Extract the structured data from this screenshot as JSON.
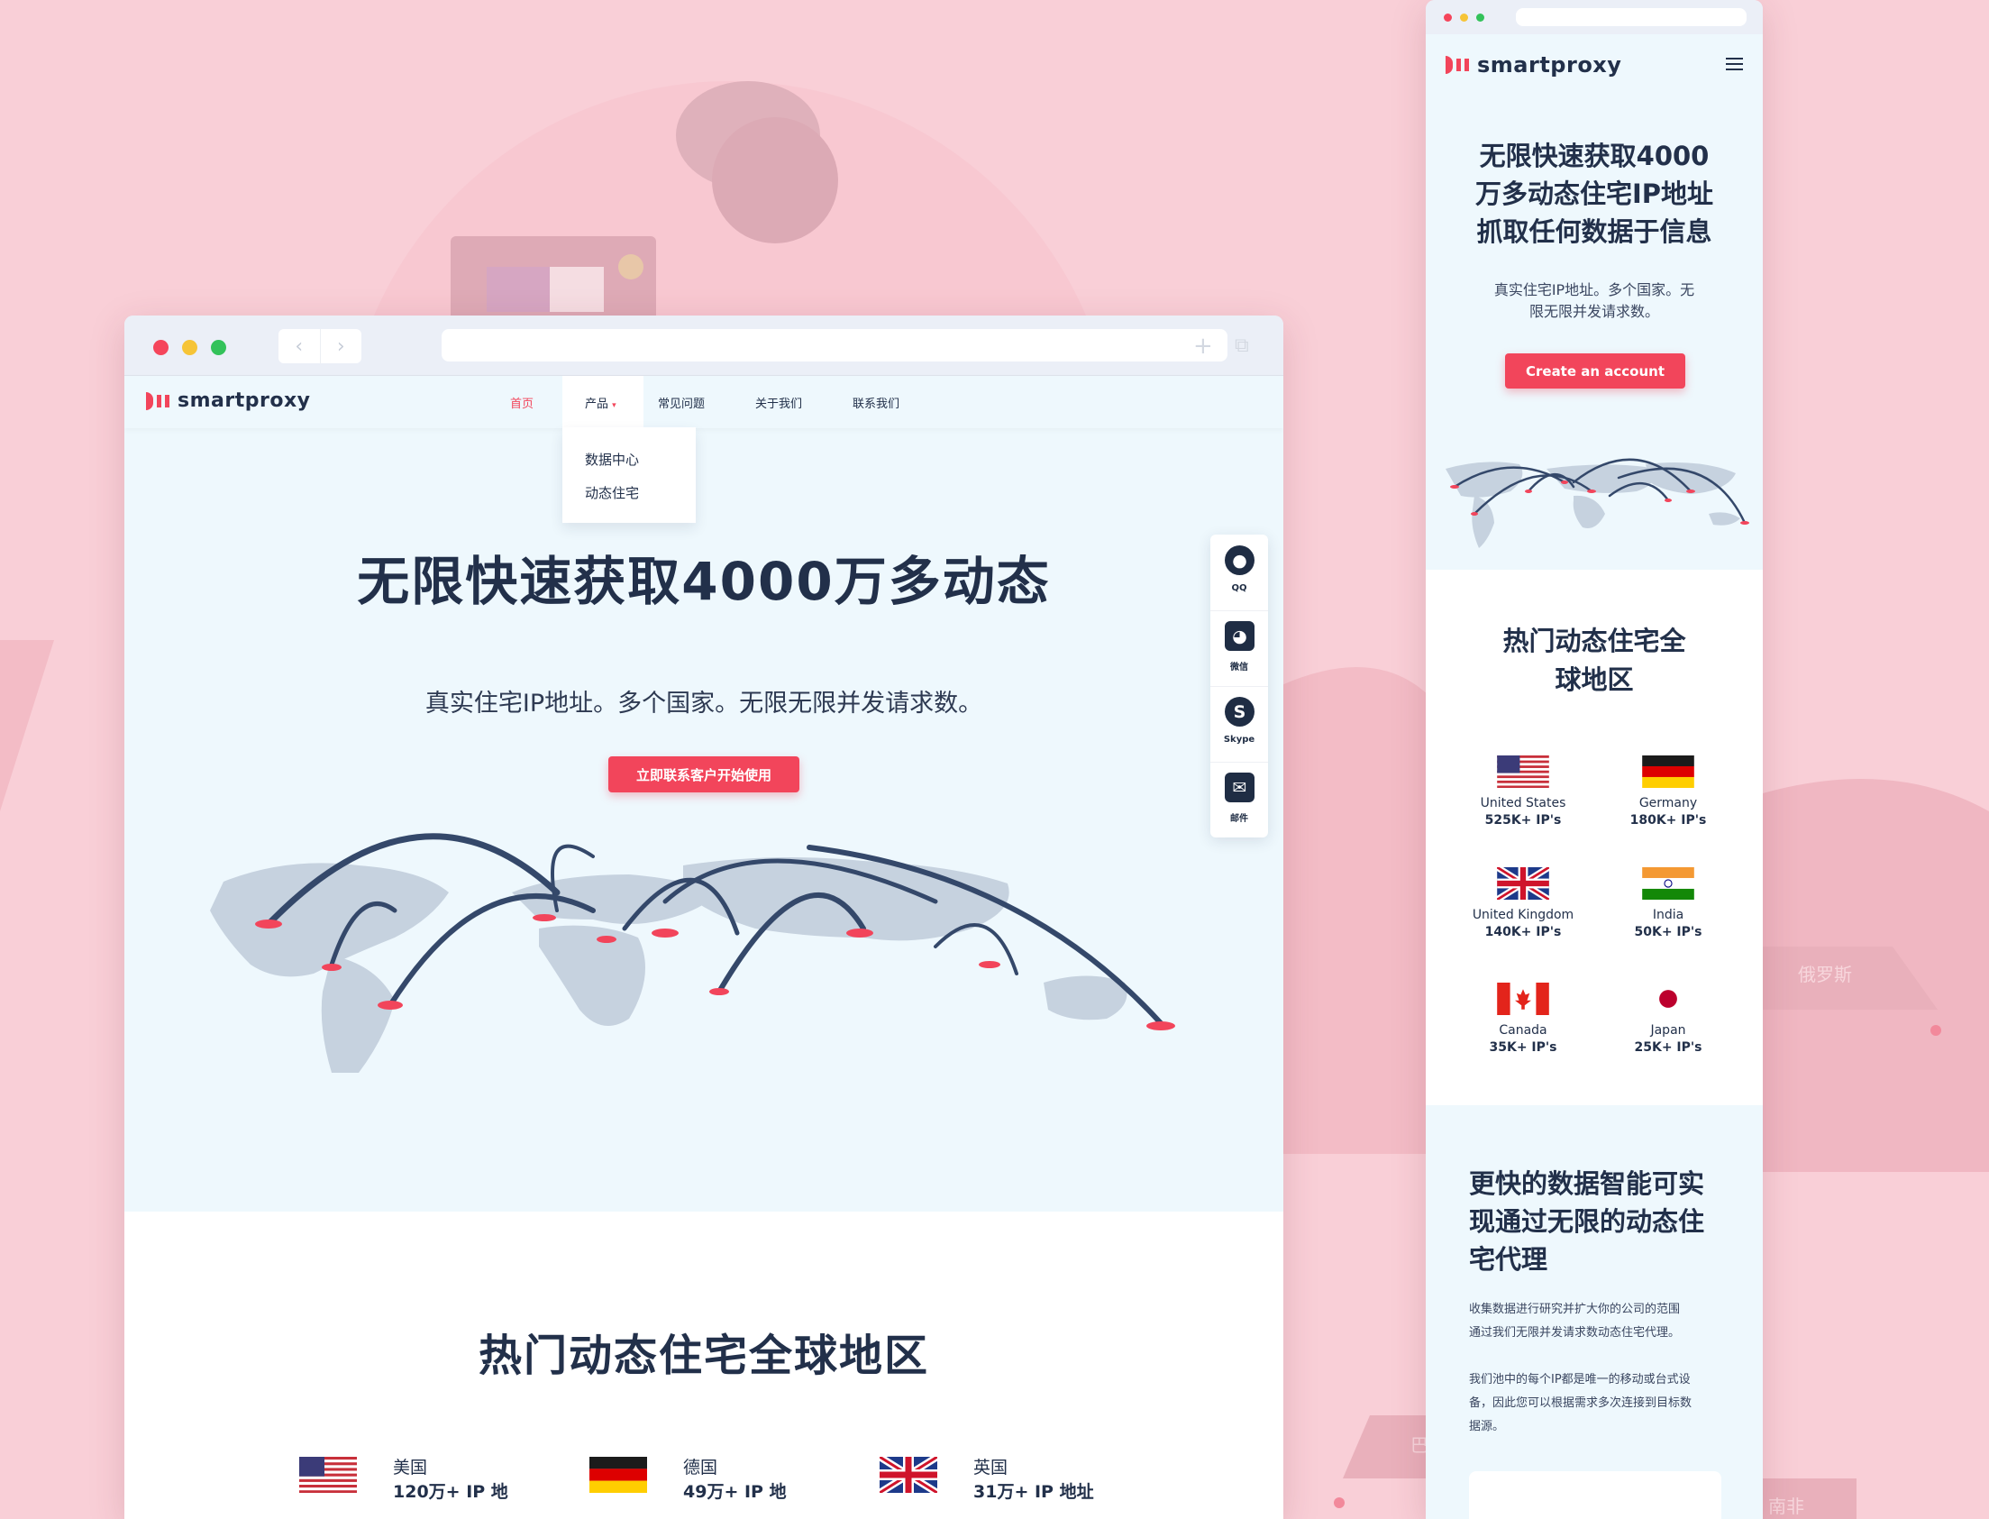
{
  "brand": {
    "name": "smartproxy",
    "accent": "#f2455b",
    "dark": "#22304a"
  },
  "desktop": {
    "nav": [
      {
        "label": "首页",
        "active": true
      },
      {
        "label": "产品",
        "dropdown": true
      },
      {
        "label": "常见问题"
      },
      {
        "label": "关于我们"
      },
      {
        "label": "联系我们"
      }
    ],
    "dropdown_items": [
      "数据中心",
      "动态住宅"
    ],
    "hero": {
      "title": "无限快速获取4000万多动态",
      "subtitle": "真实住宅IP地址。多个国家。无限无限并发请求数。",
      "cta": "立即联系客户开始使用"
    },
    "sidebar": [
      {
        "label": "QQ",
        "icon": "qq-icon"
      },
      {
        "label": "微信",
        "icon": "wechat-icon"
      },
      {
        "label": "Skype",
        "icon": "skype-icon"
      },
      {
        "label": "邮件",
        "icon": "mail-icon"
      }
    ],
    "countries_title": "热门动态住宅全球地区",
    "countries": [
      {
        "name": "美国",
        "count": "120万+ IP 地",
        "flag": "us-flag-icon"
      },
      {
        "name": "德国",
        "count": "49万+ IP 地",
        "flag": "de-flag-icon"
      },
      {
        "name": "英国",
        "count": "31万+ IP 地址",
        "flag": "uk-flag-icon"
      }
    ]
  },
  "mobile": {
    "hero": {
      "title_lines": [
        "无限快速获取4000",
        "万多动态住宅IP地址",
        "抓取任何数据于信息"
      ],
      "subtitle_lines": [
        "真实住宅IP地址。多个国家。无",
        "限无限并发请求数。"
      ],
      "cta": "Create an account"
    },
    "countries_title_lines": [
      "热门动态住宅全",
      "球地区"
    ],
    "countries": [
      {
        "name": "United States",
        "count": "525K+ IP's",
        "flag": "us-flag-icon"
      },
      {
        "name": "Germany",
        "count": "180K+ IP's",
        "flag": "de-flag-icon"
      },
      {
        "name": "United Kingdom",
        "count": "140K+ IP's",
        "flag": "uk-flag-icon"
      },
      {
        "name": "India",
        "count": "50K+ IP's",
        "flag": "in-flag-icon"
      },
      {
        "name": "Canada",
        "count": "35K+ IP's",
        "flag": "ca-flag-icon"
      },
      {
        "name": "Japan",
        "count": "25K+ IP's",
        "flag": "jp-flag-icon"
      }
    ],
    "section2": {
      "title_lines": [
        "更快的数据智能可实",
        "现通过无限的动态住",
        "宅代理"
      ],
      "para1_lines": [
        "收集数据进行研究并扩大你的公司的范围",
        "通过我们无限并发请求数动态住宅代理。"
      ],
      "para2_lines": [
        "我们池中的每个IP都是唯一的移动或台式设",
        "备，因此您可以根据需求多次连接到目标数",
        "据源。"
      ]
    }
  },
  "background_labels": [
    "俄罗斯",
    "巴",
    "南非"
  ]
}
